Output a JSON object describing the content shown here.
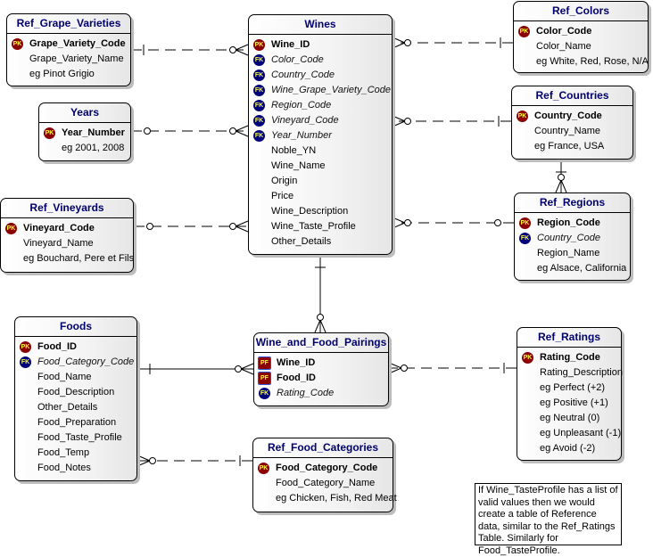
{
  "diagram": {
    "entities": {
      "ref_grape_varieties": {
        "title": "Ref_Grape_Varieties",
        "rows": [
          {
            "name": "Grape_Variety_Code",
            "key": "PK"
          },
          {
            "name": "Grape_Variety_Name"
          },
          {
            "name": "eg Pinot Grigio"
          }
        ]
      },
      "wines": {
        "title": "Wines",
        "rows": [
          {
            "name": "Wine_ID",
            "key": "PK"
          },
          {
            "name": "Color_Code",
            "key": "FK"
          },
          {
            "name": "Country_Code",
            "key": "FK"
          },
          {
            "name": "Wine_Grape_Variety_Code",
            "key": "FK"
          },
          {
            "name": "Region_Code",
            "key": "FK"
          },
          {
            "name": "Vineyard_Code",
            "key": "FK"
          },
          {
            "name": "Year_Number",
            "key": "FK"
          },
          {
            "name": "Noble_YN"
          },
          {
            "name": "Wine_Name"
          },
          {
            "name": "Origin"
          },
          {
            "name": "Price"
          },
          {
            "name": "Wine_Description"
          },
          {
            "name": "Wine_Taste_Profile"
          },
          {
            "name": "Other_Details"
          }
        ]
      },
      "ref_colors": {
        "title": "Ref_Colors",
        "rows": [
          {
            "name": "Color_Code",
            "key": "PK"
          },
          {
            "name": "Color_Name"
          },
          {
            "name": "eg White, Red, Rose, N/A"
          }
        ]
      },
      "years": {
        "title": "Years",
        "rows": [
          {
            "name": "Year_Number",
            "key": "PK"
          },
          {
            "name": "eg 2001, 2008"
          }
        ]
      },
      "ref_countries": {
        "title": "Ref_Countries",
        "rows": [
          {
            "name": "Country_Code",
            "key": "PK"
          },
          {
            "name": "Country_Name"
          },
          {
            "name": "eg France, USA"
          }
        ]
      },
      "ref_vineyards": {
        "title": "Ref_Vineyards",
        "rows": [
          {
            "name": "Vineyard_Code",
            "key": "PK"
          },
          {
            "name": "Vineyard_Name"
          },
          {
            "name": "eg Bouchard, Pere et Fils"
          }
        ]
      },
      "ref_regions": {
        "title": "Ref_Regions",
        "rows": [
          {
            "name": "Region_Code",
            "key": "PK"
          },
          {
            "name": "Country_Code",
            "key": "FK"
          },
          {
            "name": "Region_Name"
          },
          {
            "name": "eg Alsace,  California"
          }
        ]
      },
      "foods": {
        "title": "Foods",
        "rows": [
          {
            "name": "Food_ID",
            "key": "PK"
          },
          {
            "name": "Food_Category_Code",
            "key": "FK"
          },
          {
            "name": "Food_Name"
          },
          {
            "name": "Food_Description"
          },
          {
            "name": "Other_Details"
          },
          {
            "name": "Food_Preparation"
          },
          {
            "name": "Food_Taste_Profile"
          },
          {
            "name": "Food_Temp"
          },
          {
            "name": "Food_Notes"
          }
        ]
      },
      "wine_and_food_pairings": {
        "title": "Wine_and_Food_Pairings",
        "rows": [
          {
            "name": "Wine_ID",
            "key": "PF"
          },
          {
            "name": "Food_ID",
            "key": "PF"
          },
          {
            "name": "Rating_Code",
            "key": "FK"
          }
        ]
      },
      "ref_ratings": {
        "title": "Ref_Ratings",
        "rows": [
          {
            "name": "Rating_Code",
            "key": "PK"
          },
          {
            "name": "Rating_Description"
          },
          {
            "name": "eg Perfect (+2)"
          },
          {
            "name": "eg Positive (+1)"
          },
          {
            "name": "eg Neutral (0)"
          },
          {
            "name": "eg Unpleasant (-1)"
          },
          {
            "name": "eg  Avoid (-2)"
          }
        ]
      },
      "ref_food_categories": {
        "title": "Ref_Food_Categories",
        "rows": [
          {
            "name": "Food_Category_Code",
            "key": "PK"
          },
          {
            "name": "Food_Category_Name"
          },
          {
            "name": "eg Chicken, Fish, Red Meat"
          }
        ]
      }
    },
    "relationships": [
      {
        "from": "ref_grape_varieties",
        "to": "wines",
        "style": "dashed",
        "parent_end": "one",
        "child_end": "zero-or-many"
      },
      {
        "from": "ref_colors",
        "to": "wines",
        "style": "dashed",
        "parent_end": "one",
        "child_end": "zero-or-many"
      },
      {
        "from": "years",
        "to": "wines",
        "style": "dashed",
        "parent_end": "zero-or-one",
        "child_end": "zero-or-many"
      },
      {
        "from": "ref_countries",
        "to": "wines",
        "style": "dashed",
        "parent_end": "one",
        "child_end": "zero-or-many"
      },
      {
        "from": "ref_vineyards",
        "to": "wines",
        "style": "dashed",
        "parent_end": "zero-or-one",
        "child_end": "zero-or-many"
      },
      {
        "from": "ref_regions",
        "to": "wines",
        "style": "dashed",
        "parent_end": "zero-or-one",
        "child_end": "zero-or-many"
      },
      {
        "from": "ref_countries",
        "to": "ref_regions",
        "style": "solid",
        "parent_end": "one",
        "child_end": "zero-or-many"
      },
      {
        "from": "wines",
        "to": "wine_and_food_pairings",
        "style": "solid",
        "parent_end": "one",
        "child_end": "zero-or-many"
      },
      {
        "from": "foods",
        "to": "wine_and_food_pairings",
        "style": "solid",
        "parent_end": "one",
        "child_end": "zero-or-many"
      },
      {
        "from": "ref_ratings",
        "to": "wine_and_food_pairings",
        "style": "dashed",
        "parent_end": "one",
        "child_end": "zero-or-many"
      },
      {
        "from": "ref_food_categories",
        "to": "foods",
        "style": "dashed",
        "parent_end": "one",
        "child_end": "zero-or-many"
      }
    ],
    "note": "If Wine_TasteProfile has a list of valid values then we would create a table of Reference data, similar to the Ref_Ratings Table. Similarly for Food_TasteProfile."
  }
}
